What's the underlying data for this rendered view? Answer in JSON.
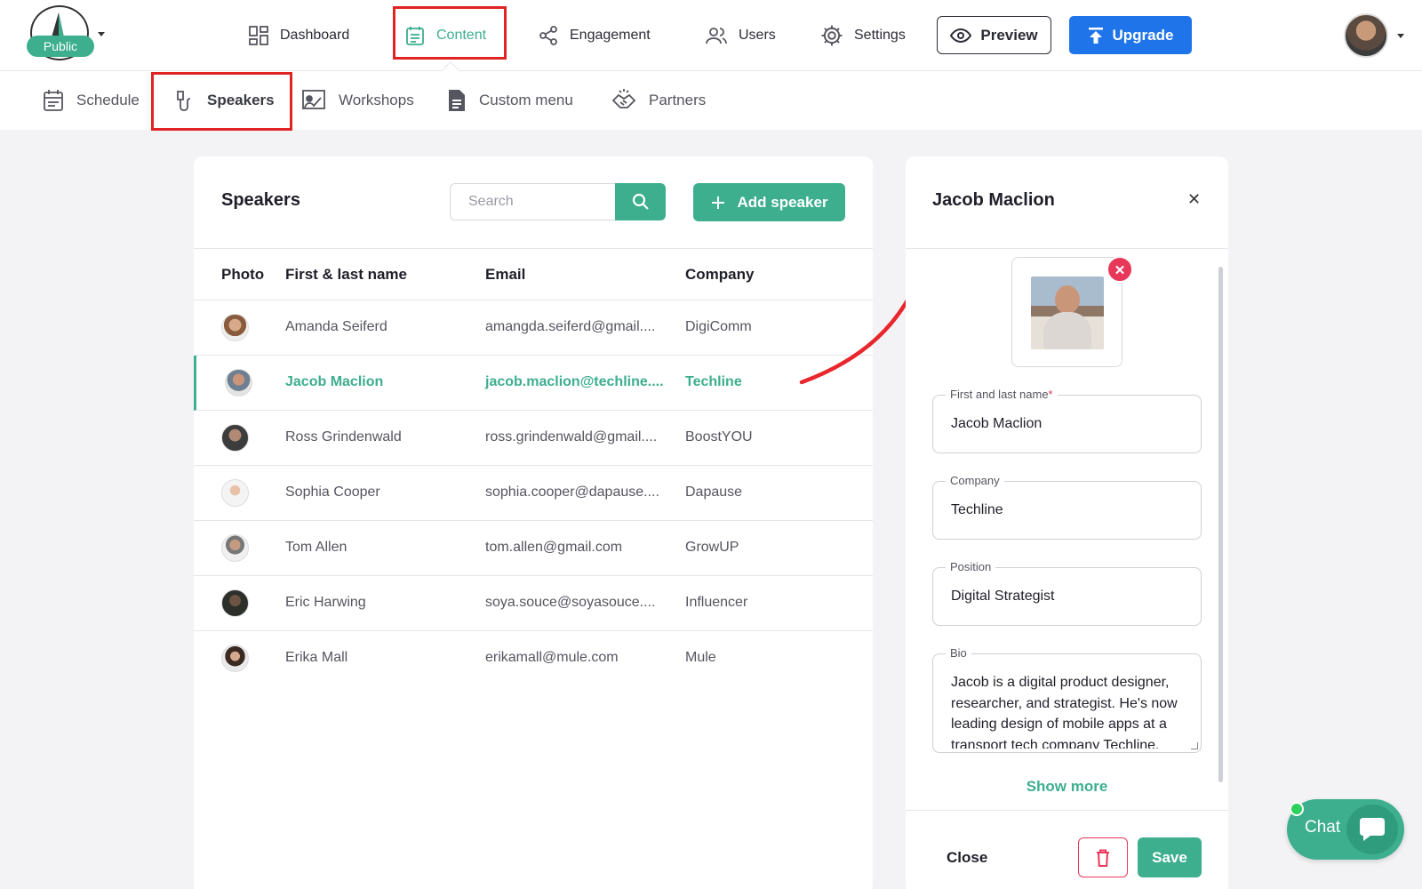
{
  "logo": {
    "badge": "Public"
  },
  "nav": {
    "dashboard": "Dashboard",
    "content": "Content",
    "engagement": "Engagement",
    "users": "Users",
    "settings": "Settings",
    "preview": "Preview",
    "upgrade": "Upgrade"
  },
  "subnav": {
    "schedule": "Schedule",
    "speakers": "Speakers",
    "workshops": "Workshops",
    "custom_menu": "Custom menu",
    "partners": "Partners"
  },
  "speakers_panel": {
    "title": "Speakers",
    "search_placeholder": "Search",
    "add_button": "Add speaker",
    "columns": [
      "Photo",
      "First & last name",
      "Email",
      "Company"
    ],
    "rows": [
      {
        "name": "Amanda Seiferd",
        "email": "amangda.seiferd@gmail....",
        "company": "DigiComm",
        "selected": false
      },
      {
        "name": "Jacob Maclion",
        "email": "jacob.maclion@techline....",
        "company": "Techline",
        "selected": true
      },
      {
        "name": "Ross Grindenwald",
        "email": "ross.grindenwald@gmail....",
        "company": "BoostYOU",
        "selected": false
      },
      {
        "name": "Sophia Cooper",
        "email": "sophia.cooper@dapause....",
        "company": "Dapause",
        "selected": false
      },
      {
        "name": "Tom Allen",
        "email": "tom.allen@gmail.com",
        "company": "GrowUP",
        "selected": false
      },
      {
        "name": "Eric Harwing",
        "email": "soya.souce@soyasouce....",
        "company": "Influencer",
        "selected": false
      },
      {
        "name": "Erika Mall",
        "email": "erikamall@mule.com",
        "company": "Mule",
        "selected": false
      }
    ]
  },
  "detail": {
    "title": "Jacob Maclion",
    "fields": {
      "name_label": "First and last name",
      "name_required": "*",
      "name_value": "Jacob Maclion",
      "company_label": "Company",
      "company_value": "Techline",
      "position_label": "Position",
      "position_value": "Digital Strategist",
      "bio_label": "Bio",
      "bio_value": "Jacob is a digital product designer, researcher, and strategist. He's now leading design of mobile apps at a transport tech company Techline."
    },
    "show_more": "Show more",
    "close": "Close",
    "save": "Save"
  },
  "chat": {
    "label": "Chat"
  },
  "colors": {
    "accent": "#3dae8e",
    "primary": "#1f74ea",
    "danger": "#e8385a",
    "highlight": "#e02424"
  }
}
